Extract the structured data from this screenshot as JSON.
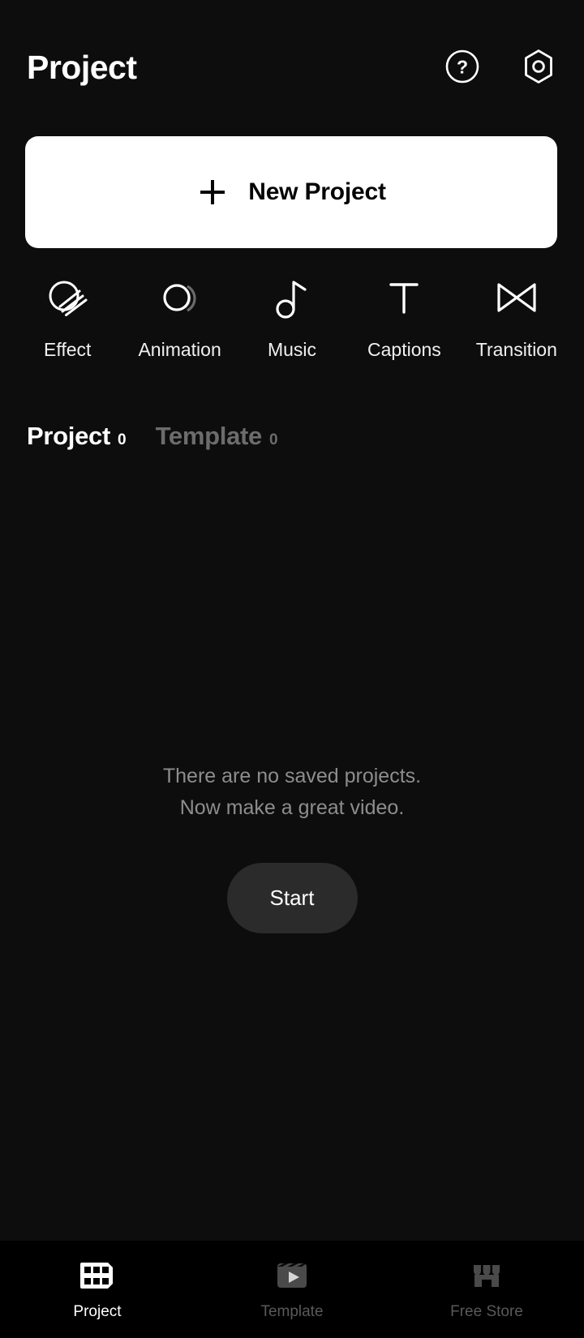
{
  "header": {
    "title": "Project",
    "help_icon": "help-circle-icon",
    "settings_icon": "hex-settings-icon"
  },
  "new_project": {
    "label": "New Project",
    "plus_icon": "plus-icon",
    "background_color": "#ffffff",
    "text_color": "#050505"
  },
  "features": [
    {
      "label": "Effect",
      "icon": "effect-icon"
    },
    {
      "label": "Animation",
      "icon": "animation-icon"
    },
    {
      "label": "Music",
      "icon": "music-note-icon"
    },
    {
      "label": "Captions",
      "icon": "text-t-icon"
    },
    {
      "label": "Transition",
      "icon": "transition-bowtie-icon"
    }
  ],
  "tabs": [
    {
      "label": "Project",
      "count": "0",
      "active": true
    },
    {
      "label": "Template",
      "count": "0",
      "active": false
    }
  ],
  "empty_state": {
    "line1": "There are no saved projects.",
    "line2": "Now make a great video.",
    "start_label": "Start",
    "text_color": "#8d8d8d",
    "button_color": "#2b2b2b"
  },
  "bottom_nav": [
    {
      "label": "Project",
      "icon": "filmstrip-icon",
      "active": true
    },
    {
      "label": "Template",
      "icon": "clapperboard-icon",
      "active": false
    },
    {
      "label": "Free Store",
      "icon": "storefront-icon",
      "active": false
    }
  ],
  "colors": {
    "background": "#0d0d0d",
    "nav_background": "#000000",
    "active": "#ffffff",
    "inactive": "#6c6c6c"
  }
}
